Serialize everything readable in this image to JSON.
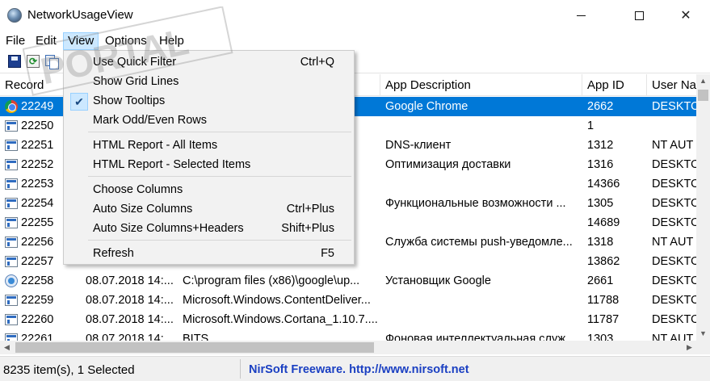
{
  "window": {
    "title": "NetworkUsageView",
    "controls": [
      "minimize",
      "maximize",
      "close"
    ]
  },
  "menubar": {
    "items": [
      "File",
      "Edit",
      "View",
      "Options",
      "Help"
    ],
    "active": "View"
  },
  "toolbar": {
    "buttons": [
      "save-icon",
      "refresh-icon",
      "copy-icon"
    ]
  },
  "columns": [
    "Record",
    "",
    "",
    "App Description",
    "App ID",
    "User Na"
  ],
  "rows": [
    {
      "record": "22249",
      "col2": "",
      "col3": "hr",
      "desc": "Google Chrome",
      "app_id": "2662",
      "user": "DESKTO",
      "icon": "chrome",
      "selected": true
    },
    {
      "record": "22250",
      "col2": "",
      "col3": "",
      "desc": "",
      "app_id": "1",
      "user": "",
      "icon": "app"
    },
    {
      "record": "22251",
      "col2": "",
      "col3": "",
      "desc": "DNS-клиент",
      "app_id": "1312",
      "user": "NT AUT",
      "icon": "app"
    },
    {
      "record": "22252",
      "col2": "",
      "col3": "",
      "desc": "Оптимизация доставки",
      "app_id": "1316",
      "user": "DESKTO",
      "icon": "app"
    },
    {
      "record": "22253",
      "col2": "",
      "col3": "10...",
      "desc": "",
      "app_id": "14366",
      "user": "DESKTO",
      "icon": "app"
    },
    {
      "record": "22254",
      "col2": "",
      "col3": "",
      "desc": "Функциональные возможности ...",
      "app_id": "1305",
      "user": "DESKTO",
      "icon": "app"
    },
    {
      "record": "22255",
      "col2": "",
      "col3": "",
      "desc": "",
      "app_id": "14689",
      "user": "DESKTO",
      "icon": "app"
    },
    {
      "record": "22256",
      "col2": "",
      "col3": "",
      "desc": "Служба системы push-уведомле...",
      "app_id": "1318",
      "user": "NT AUT",
      "icon": "app"
    },
    {
      "record": "22257",
      "col2": "",
      "col3": "1...",
      "desc": "",
      "app_id": "13862",
      "user": "DESKTO",
      "icon": "app"
    },
    {
      "record": "22258",
      "col2": "08.07.2018 14:...",
      "col3": "C:\\program files (x86)\\google\\up...",
      "desc": "Установщик Google",
      "app_id": "2661",
      "user": "DESKTO",
      "icon": "updater"
    },
    {
      "record": "22259",
      "col2": "08.07.2018 14:...",
      "col3": "Microsoft.Windows.ContentDeliver...",
      "desc": "",
      "app_id": "11788",
      "user": "DESKTO",
      "icon": "app"
    },
    {
      "record": "22260",
      "col2": "08.07.2018 14:...",
      "col3": "Microsoft.Windows.Cortana_1.10.7....",
      "desc": "",
      "app_id": "11787",
      "user": "DESKTO",
      "icon": "app"
    },
    {
      "record": "22261",
      "col2": "08.07.2018 14:...",
      "col3": "BITS",
      "desc": "Фоновая интеллектуальная служ...",
      "app_id": "1303",
      "user": "NT AUT",
      "icon": "app"
    }
  ],
  "view_menu": {
    "items": [
      {
        "label": "Use Quick Filter",
        "shortcut": "Ctrl+Q",
        "checked": false
      },
      {
        "label": "Show Grid Lines",
        "shortcut": "",
        "checked": false
      },
      {
        "label": "Show Tooltips",
        "shortcut": "",
        "checked": true
      },
      {
        "label": "Mark Odd/Even Rows",
        "shortcut": "",
        "checked": false
      },
      {
        "label": "HTML Report - All Items",
        "shortcut": "",
        "checked": false
      },
      {
        "label": "HTML Report - Selected Items",
        "shortcut": "",
        "checked": false
      },
      {
        "label": "Choose Columns",
        "shortcut": "",
        "checked": false
      },
      {
        "label": "Auto Size Columns",
        "shortcut": "Ctrl+Plus",
        "checked": false
      },
      {
        "label": "Auto Size Columns+Headers",
        "shortcut": "Shift+Plus",
        "checked": false
      },
      {
        "label": "Refresh",
        "shortcut": "F5",
        "checked": false
      }
    ],
    "check_mark": "✔"
  },
  "statusbar": {
    "left": "8235 item(s), 1 Selected",
    "right": "NirSoft Freeware.  http://www.nirsoft.net"
  },
  "watermark": {
    "text": "PORTAL",
    "sub": "www.softportal.com",
    "prefix": "SOFT"
  },
  "colors": {
    "selection": "#0078d7",
    "menu_active": "#cce8ff",
    "status_link": "#1a3fc2",
    "menu_bg": "#f2f2f2"
  }
}
